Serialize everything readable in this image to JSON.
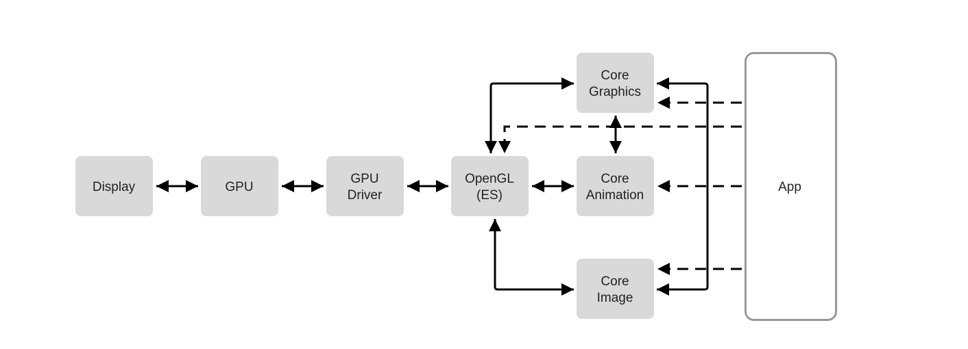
{
  "nodes": {
    "display": [
      "Display"
    ],
    "gpu": [
      "GPU"
    ],
    "gpu_driver": [
      "GPU",
      "Driver"
    ],
    "opengl": [
      "OpenGL",
      "(ES)"
    ],
    "core_graphics": [
      "Core",
      "Graphics"
    ],
    "core_animation": [
      "Core",
      "Animation"
    ],
    "core_image": [
      "Core",
      "Image"
    ],
    "app": [
      "App"
    ]
  },
  "edges": [
    {
      "from": "display",
      "to": "gpu",
      "style": "solid",
      "direction": "both"
    },
    {
      "from": "gpu",
      "to": "gpu_driver",
      "style": "solid",
      "direction": "both"
    },
    {
      "from": "gpu_driver",
      "to": "opengl",
      "style": "solid",
      "direction": "both"
    },
    {
      "from": "opengl",
      "to": "core_animation",
      "style": "solid",
      "direction": "both"
    },
    {
      "from": "opengl",
      "to": "core_graphics",
      "style": "solid",
      "direction": "both"
    },
    {
      "from": "opengl",
      "to": "core_image",
      "style": "solid",
      "direction": "both"
    },
    {
      "from": "core_graphics",
      "to": "core_animation",
      "style": "solid",
      "direction": "both"
    },
    {
      "from": "core_graphics",
      "to": "core_image",
      "style": "solid",
      "direction": "both"
    },
    {
      "from": "app",
      "to": "core_graphics",
      "style": "dashed",
      "direction": "forward"
    },
    {
      "from": "app",
      "to": "opengl",
      "style": "dashed",
      "direction": "forward"
    },
    {
      "from": "app",
      "to": "core_animation",
      "style": "dashed",
      "direction": "forward"
    },
    {
      "from": "app",
      "to": "core_image",
      "style": "dashed",
      "direction": "forward"
    }
  ],
  "colors": {
    "node_fill": "#d9d9d9",
    "app_border": "#999999",
    "line": "#000000"
  }
}
